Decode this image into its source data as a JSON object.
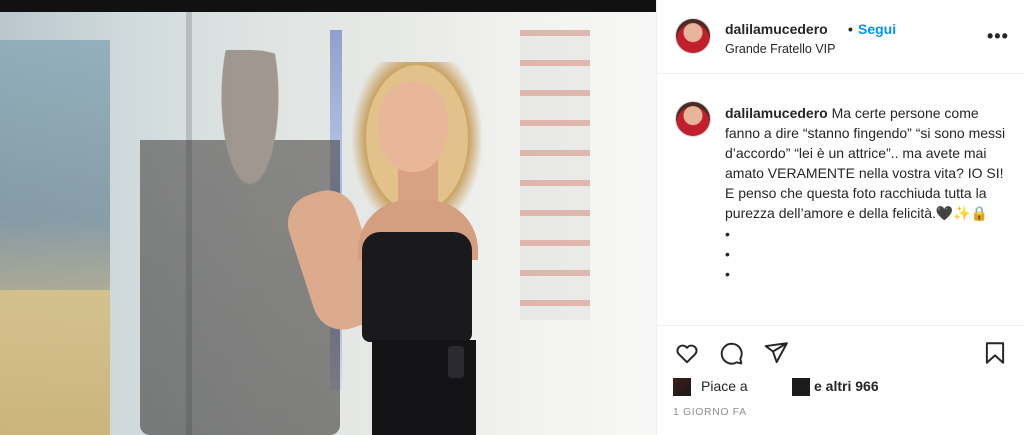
{
  "post": {
    "username": "dalilamucedero",
    "separator": "•",
    "follow_label": "Segui",
    "location": "Grande Fratello VIP",
    "more_label": "•••"
  },
  "caption": {
    "username": "dalilamucedero",
    "text": "Ma certe persone come fanno a dire “stanno fingendo” “si sono messi d’accordo” “lei è un attrice”.. ma avete mai amato VERAMENTE nella vostra vita? IO SI! E penso che questa foto racchiuda tutta la purezza dell’amore e della felicità.🖤✨🔒",
    "dots": [
      "•",
      "•",
      "•"
    ]
  },
  "actions": {
    "like_icon": "heart-icon",
    "comment_icon": "comment-icon",
    "share_icon": "paper-plane-icon",
    "save_icon": "bookmark-icon"
  },
  "likes": {
    "prefix": "Piace a",
    "and_others": "e altri 966"
  },
  "timestamp": "1 GIORNO FA",
  "colors": {
    "accent": "#0095f6",
    "text": "#262626",
    "muted": "#8e8e8e",
    "border": "#efefef"
  }
}
